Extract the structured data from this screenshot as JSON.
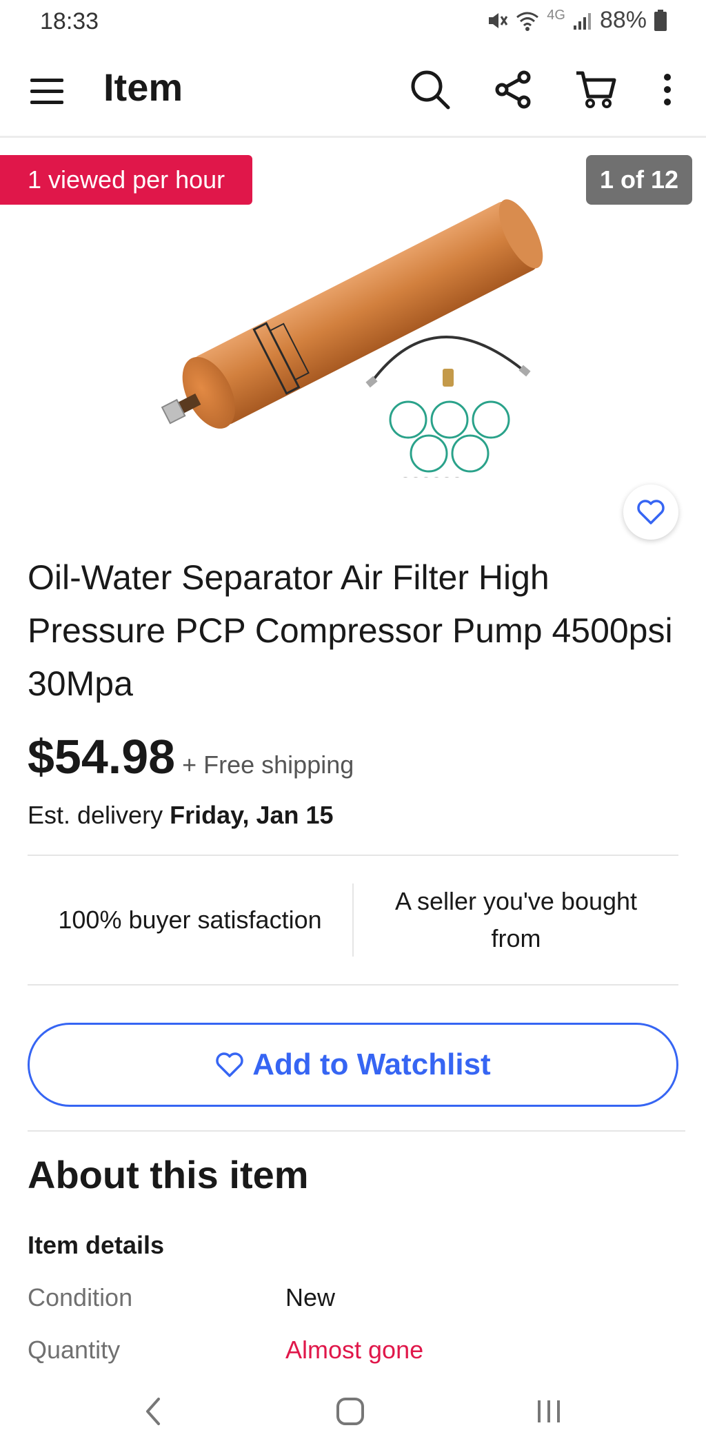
{
  "status": {
    "time": "18:33",
    "network": "4G",
    "battery": "88%"
  },
  "appbar": {
    "title": "Item",
    "icons": [
      "menu-icon",
      "search-icon",
      "share-icon",
      "cart-icon",
      "more-icon"
    ]
  },
  "gallery": {
    "views_badge": "1 viewed per hour",
    "counter": "1 of 12",
    "image_description_icon": "product-image"
  },
  "item": {
    "title": "Oil-Water Separator Air Filter High Pressure PCP Compressor Pump 4500psi 30Mpa",
    "price": "$54.98",
    "shipping": "+ Free shipping",
    "delivery_label": "Est. delivery ",
    "delivery_date": "Friday, Jan 15"
  },
  "seller": {
    "satisfaction": "100% buyer satisfaction",
    "history": "A seller you've bought from"
  },
  "actions": {
    "watchlist_label": "Add to Watchlist"
  },
  "about": {
    "heading": "About this item",
    "details_heading": "Item details",
    "rows": [
      {
        "label": "Condition",
        "value": "New"
      },
      {
        "label": "Quantity",
        "value": "Almost gone"
      }
    ]
  },
  "colors": {
    "accent": "#3665f3",
    "urgency": "#e0174a",
    "badge_gray": "#707070"
  }
}
